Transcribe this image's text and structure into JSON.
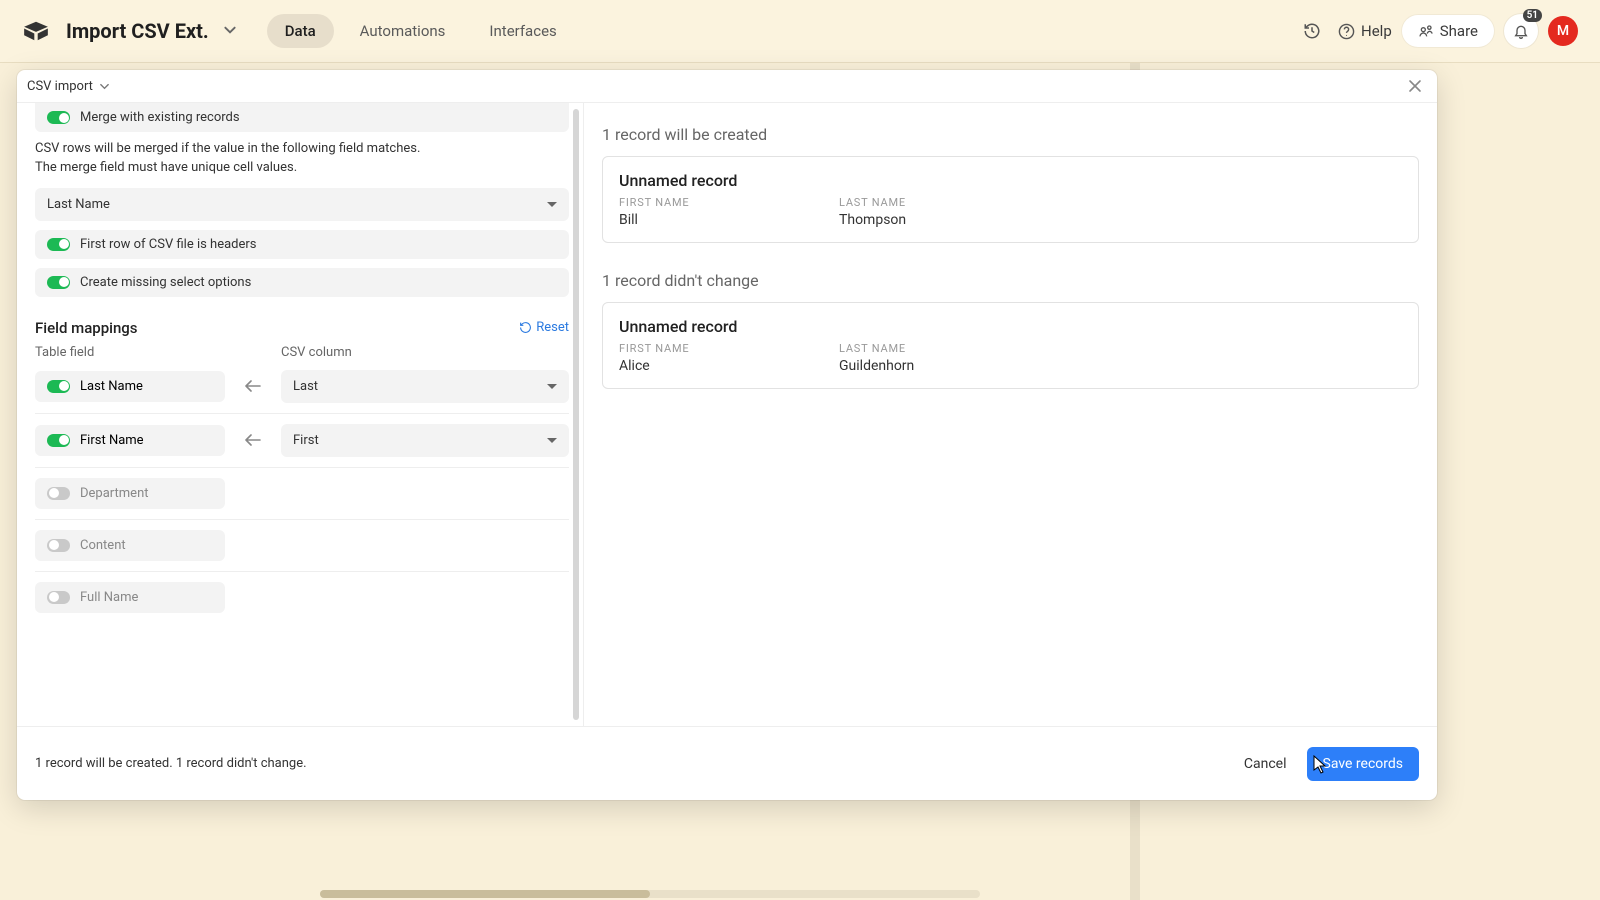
{
  "topbar": {
    "base_title": "Import CSV Ext.",
    "tabs": {
      "data": "Data",
      "automations": "Automations",
      "interfaces": "Interfaces"
    },
    "help": "Help",
    "share": "Share",
    "notif_count": "51",
    "avatar_initial": "M"
  },
  "dialog": {
    "title": "CSV import",
    "merge_label": "Merge with existing records",
    "merge_help_1": "CSV rows will be merged if the value in the following field matches.",
    "merge_help_2": "The merge field must have unique cell values.",
    "merge_field_value": "Last Name",
    "first_row_headers_label": "First row of CSV file is headers",
    "create_missing_label": "Create missing select options",
    "field_mappings_title": "Field mappings",
    "reset_label": "Reset",
    "col_table_field": "Table field",
    "col_csv_column": "CSV column",
    "mappings": [
      {
        "field": "Last Name",
        "csv": "Last",
        "on": true,
        "has_csv": true
      },
      {
        "field": "First Name",
        "csv": "First",
        "on": true,
        "has_csv": true
      },
      {
        "field": "Department",
        "csv": "",
        "on": false,
        "has_csv": false
      },
      {
        "field": "Content",
        "csv": "",
        "on": false,
        "has_csv": false
      },
      {
        "field": "Full Name",
        "csv": "",
        "on": false,
        "has_csv": false
      }
    ],
    "preview": {
      "created_heading": "1 record will be created",
      "unchanged_heading": "1 record didn't change",
      "field_label_first": "First Name",
      "field_label_last": "Last Name",
      "created": [
        {
          "title": "Unnamed record",
          "first": "Bill",
          "last": "Thompson"
        }
      ],
      "unchanged": [
        {
          "title": "Unnamed record",
          "first": "Alice",
          "last": "Guildenhorn"
        }
      ]
    },
    "footer_summary": "1 record will be created. 1 record didn't change.",
    "cancel": "Cancel",
    "save": "Save records"
  }
}
